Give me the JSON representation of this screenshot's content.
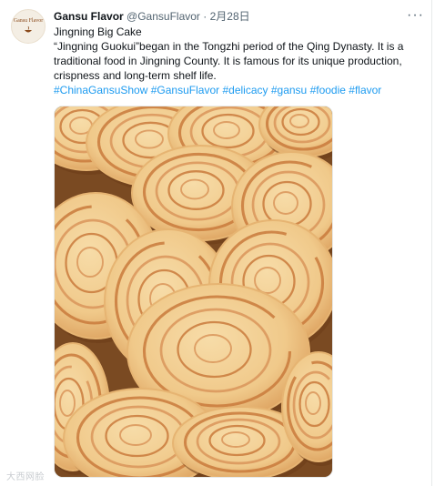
{
  "tweet": {
    "avatar_label": "Gansu Flavor",
    "display_name": "Gansu Flavor",
    "handle": "@GansuFlavor",
    "separator": "·",
    "date": "2月28日",
    "more_icon": "more-horizontal-icon",
    "lines": [
      "Jingning Big Cake",
      "“Jingning Guokui”began in the Tongzhi period of the Qing Dynasty. It is a",
      "traditional food in Jingning County. It is famous for its unique production,",
      "crispness and long-term shelf life."
    ],
    "hashtags": [
      "#ChinaGansuShow",
      "#GansuFlavor",
      "#delicacy",
      "#gansu",
      "#foodie",
      "#flavor"
    ],
    "media_alt": "Jingning Big Cake photo"
  },
  "watermark": "大西网脸",
  "colors": {
    "link": "#1d9bf0",
    "text": "#0f1419",
    "muted": "#536471"
  }
}
